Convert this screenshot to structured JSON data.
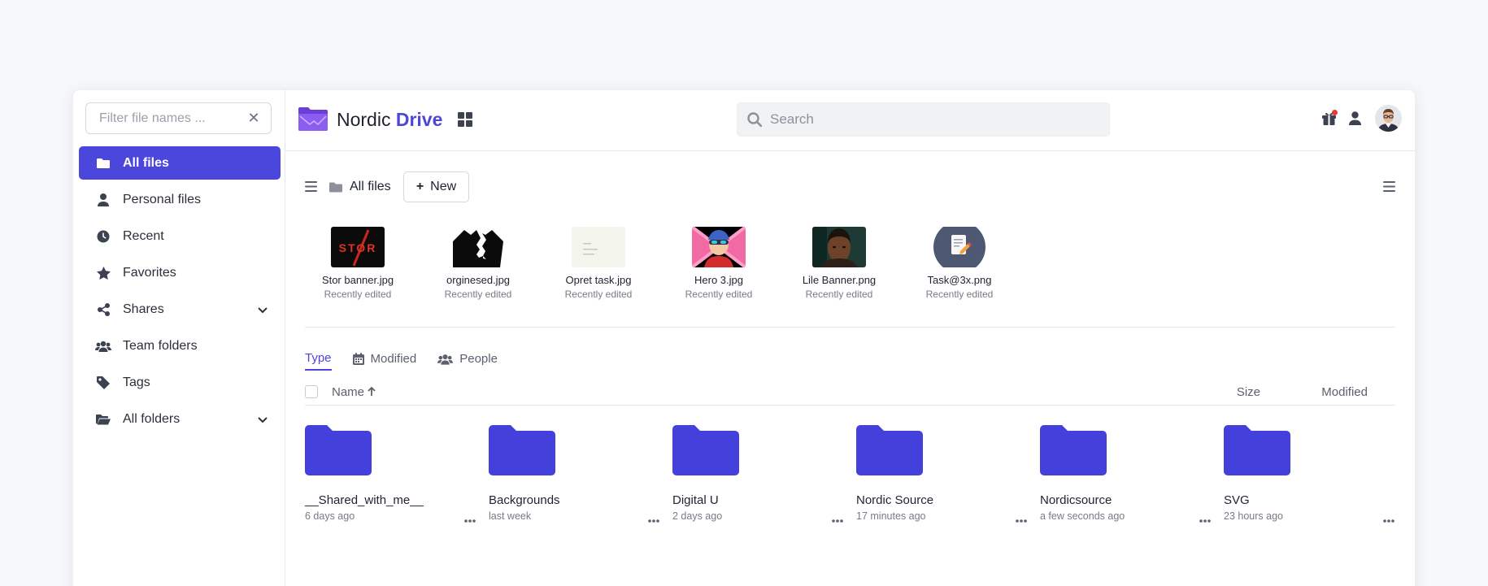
{
  "sidebar": {
    "filter_placeholder": "Filter file names ...",
    "items": [
      {
        "label": "All files",
        "icon": "folder-icon",
        "active": true
      },
      {
        "label": "Personal files",
        "icon": "user-icon"
      },
      {
        "label": "Recent",
        "icon": "clock-icon"
      },
      {
        "label": "Favorites",
        "icon": "star-icon"
      },
      {
        "label": "Shares",
        "icon": "share-icon",
        "expandable": true
      },
      {
        "label": "Team folders",
        "icon": "users-icon"
      },
      {
        "label": "Tags",
        "icon": "tag-icon"
      },
      {
        "label": "All folders",
        "icon": "folder-open-icon",
        "expandable": true
      }
    ]
  },
  "header": {
    "brand_first": "Nordic",
    "brand_second": "Drive",
    "search_placeholder": "Search",
    "accent": "#4b46dc",
    "notification_color": "#e53a3a"
  },
  "toolbar": {
    "breadcrumb": "All files",
    "new_label": "New"
  },
  "recent": [
    {
      "name": "Stor banner.jpg",
      "sub": "Recently edited"
    },
    {
      "name": "orginesed.jpg",
      "sub": "Recently edited"
    },
    {
      "name": "Opret task.jpg",
      "sub": "Recently edited"
    },
    {
      "name": "Hero 3.jpg",
      "sub": "Recently edited"
    },
    {
      "name": "Lile Banner.png",
      "sub": "Recently edited"
    },
    {
      "name": "Task@3x.png",
      "sub": "Recently edited"
    }
  ],
  "tabs": [
    {
      "label": "Type",
      "active": true
    },
    {
      "label": "Modified"
    },
    {
      "label": "People"
    }
  ],
  "table": {
    "col_name": "Name",
    "col_size": "Size",
    "col_modified": "Modified"
  },
  "folders": [
    {
      "name": "__Shared_with_me__",
      "time": "6 days ago"
    },
    {
      "name": "Backgrounds",
      "time": "last week"
    },
    {
      "name": "Digital U",
      "time": "2 days ago"
    },
    {
      "name": "Nordic Source",
      "time": "17 minutes ago"
    },
    {
      "name": "Nordicsource",
      "time": "a few seconds ago"
    },
    {
      "name": "SVG",
      "time": "23 hours ago"
    }
  ]
}
